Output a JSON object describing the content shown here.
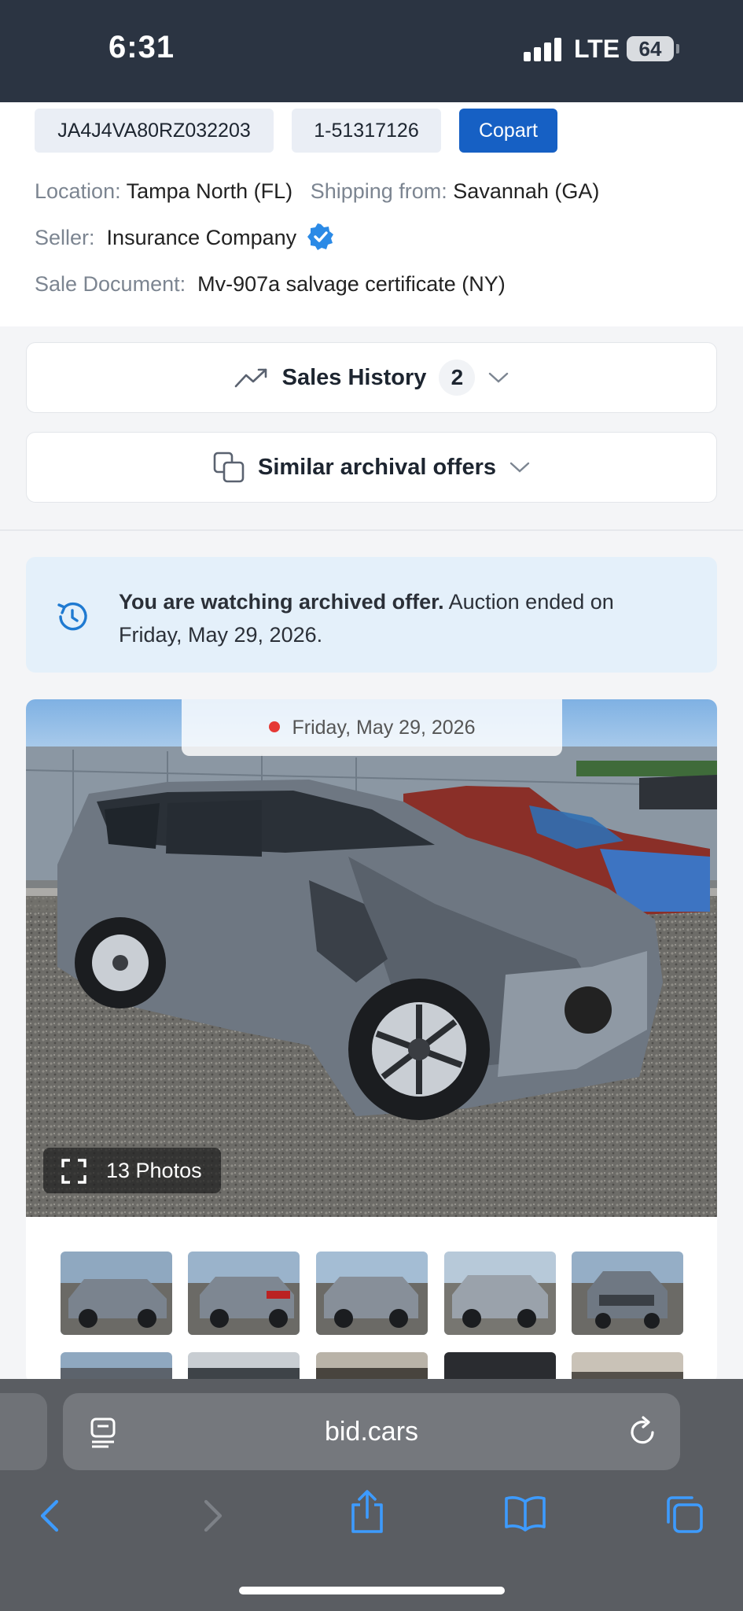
{
  "status_bar": {
    "time": "6:31",
    "network": "LTE",
    "battery": "64"
  },
  "listing": {
    "vin": "JA4J4VA80RZ032203",
    "lot": "1-51317126",
    "auction": "Copart",
    "location_label": "Location:",
    "location_value": "Tampa North (FL)",
    "shipping_label": "Shipping from:",
    "shipping_value": "Savannah (GA)",
    "seller_label": "Seller:",
    "seller_value": "Insurance Company",
    "sale_doc_label": "Sale Document:",
    "sale_doc_value": "Mv-907a salvage certificate (NY)"
  },
  "accordions": {
    "sales_history_label": "Sales History",
    "sales_history_count": "2",
    "similar_label": "Similar archival offers"
  },
  "banner": {
    "bold": "You are watching archived offer.",
    "rest": " Auction ended on Friday, May 29, 2026."
  },
  "gallery": {
    "date": "Friday, May 29, 2026",
    "photos_label": "13 Photos"
  },
  "browser": {
    "url": "bid.cars"
  },
  "colors": {
    "accent": "#1660c4",
    "status_bar": "#2b3442",
    "banner_bg": "#e4f0fa",
    "verified": "#2b8ae6"
  }
}
